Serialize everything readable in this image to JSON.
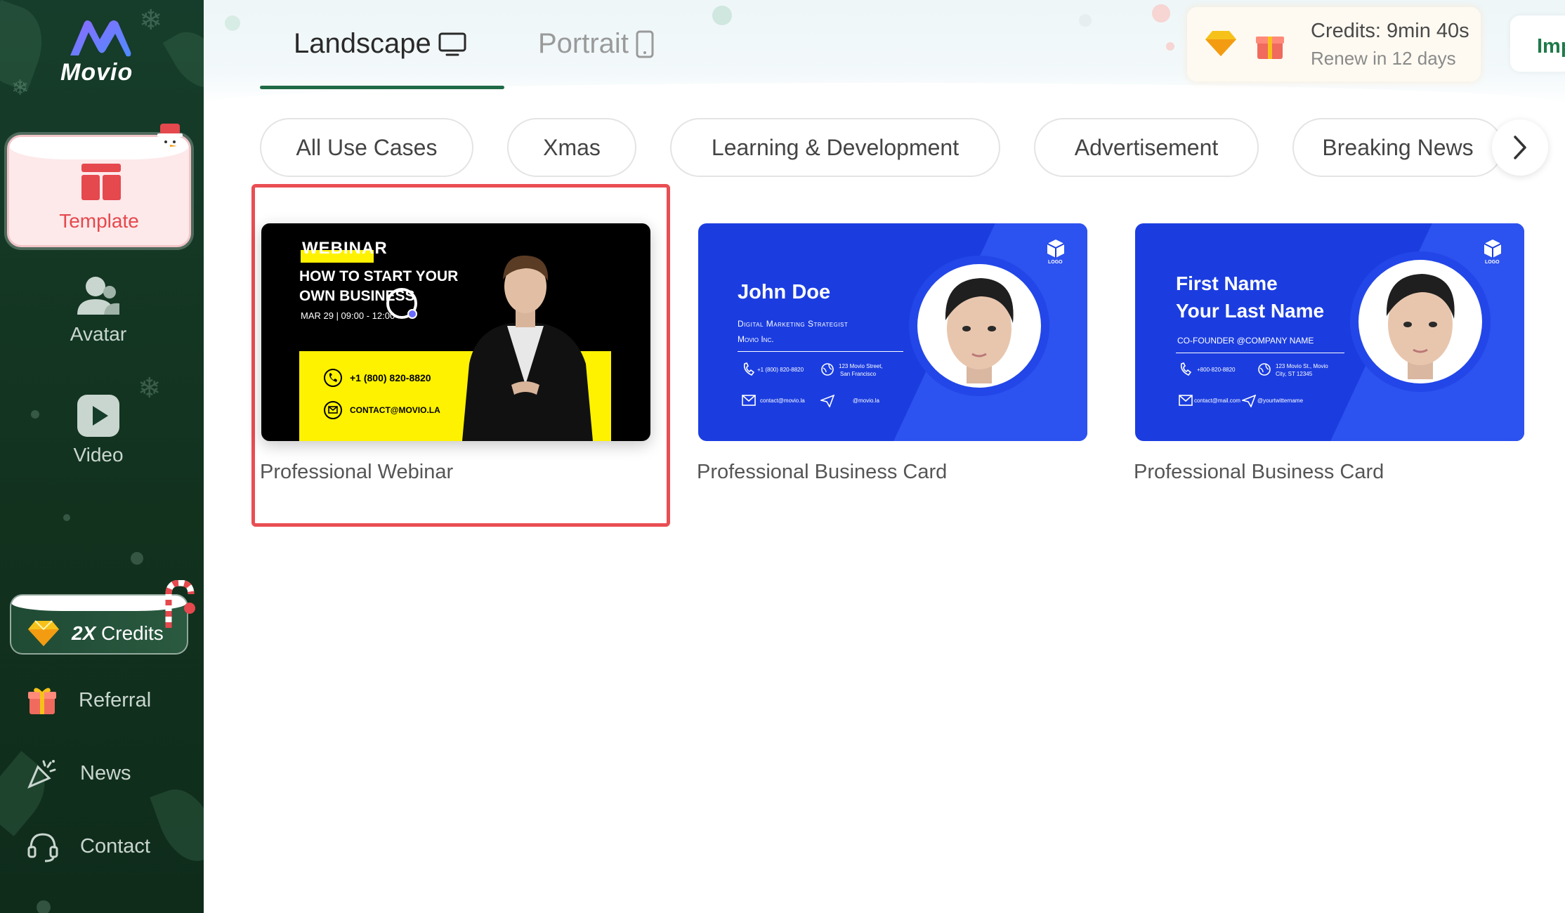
{
  "sidebar": {
    "logo_text": "Movio",
    "template_label": "Template",
    "avatar_label": "Avatar",
    "video_label": "Video",
    "credits_badge": {
      "multiplier": "2X",
      "label": "Credits"
    },
    "bottom_items": [
      {
        "label": "Referral",
        "icon": "gift-icon"
      },
      {
        "label": "News",
        "icon": "party-popper-icon"
      },
      {
        "label": "Contact",
        "icon": "headset-icon"
      }
    ]
  },
  "header": {
    "tabs": [
      {
        "label": "Landscape",
        "icon": "monitor-icon",
        "active": true
      },
      {
        "label": "Portrait",
        "icon": "phone-icon",
        "active": false
      }
    ],
    "credits": {
      "title": "Credits: 9min 40s",
      "renew": "Renew in 12 days"
    },
    "cut_button_label": "Imp"
  },
  "filters": [
    "All Use Cases",
    "Xmas",
    "Learning & Development",
    "Advertisement",
    "Breaking News"
  ],
  "templates": [
    {
      "title": "Professional Webinar",
      "thumb": {
        "badge": "WEBINAR",
        "headline_1": "HOW TO START YOUR",
        "headline_2": "OWN BUSINESS",
        "date": "MAR 29 | 09:00 - 12:00",
        "phone": "+1 (800) 820-8820",
        "email": "CONTACT@MOVIO.LA"
      }
    },
    {
      "title": "Professional Business Card",
      "thumb": {
        "name": "John Doe",
        "role": "Digital Marketing Strategist",
        "company": "Movio Inc.",
        "phone": "+1 (800) 820-8820",
        "address_1": "123 Movio Street,",
        "address_2": "San Francisco",
        "email": "contact@movio.la",
        "social": "@movio.la",
        "logo": "LOGO"
      }
    },
    {
      "title": "Professional Business Card",
      "thumb": {
        "name_1": "First Name",
        "name_2": "Your Last Name",
        "role": "CO-FOUNDER @COMPANY NAME",
        "phone": "+800-820-8820",
        "address_1": "123 Movio St., Movio",
        "address_2": "City, ST 12345",
        "email": "contact@mail.com",
        "social": "@yourtwittername",
        "logo": "LOGO"
      }
    }
  ],
  "colors": {
    "sidebar_bg": "#163d2b",
    "accent_green": "#1f6b45",
    "highlight_red": "#e94e53",
    "template_red": "#e5484d",
    "card_blue": "#1b3de0",
    "webinar_yellow": "#fff200"
  }
}
